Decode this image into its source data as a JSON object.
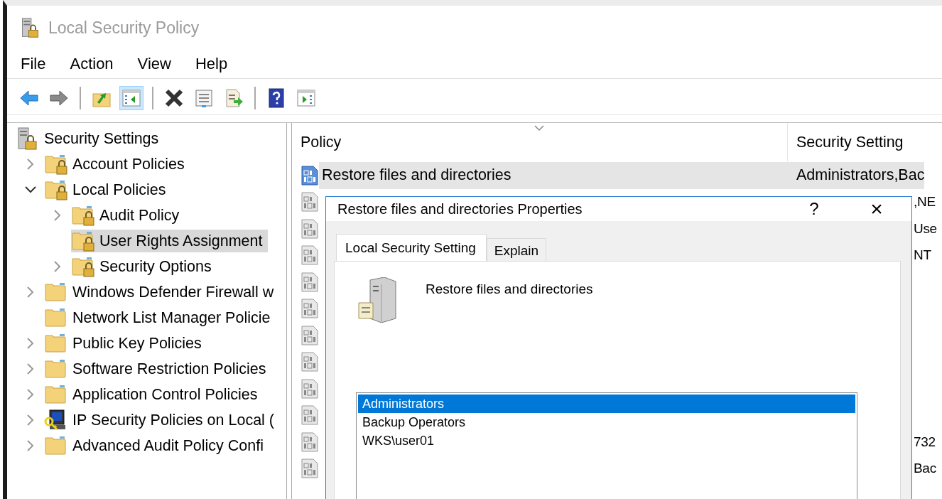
{
  "window": {
    "title": "Local Security Policy"
  },
  "menu": [
    "File",
    "Action",
    "View",
    "Help"
  ],
  "toolbar": [
    {
      "kind": "back"
    },
    {
      "kind": "forward"
    },
    {
      "kind": "separator"
    },
    {
      "kind": "up-folder"
    },
    {
      "kind": "console-tree",
      "pressed": true
    },
    {
      "kind": "separator"
    },
    {
      "kind": "delete"
    },
    {
      "kind": "properties"
    },
    {
      "kind": "export"
    },
    {
      "kind": "separator"
    },
    {
      "kind": "help"
    },
    {
      "kind": "action-pane"
    }
  ],
  "tree": {
    "label": "Security Settings",
    "kind": "server-lock",
    "selected": false,
    "children": [
      {
        "label": "Account Policies",
        "kind": "locked-folder",
        "expanded": false,
        "selected": false
      },
      {
        "label": "Local Policies",
        "kind": "locked-folder",
        "expanded": true,
        "selected": false,
        "children": [
          {
            "label": "Audit Policy",
            "kind": "locked-folder",
            "expanded": false,
            "selected": false
          },
          {
            "label": "User Rights Assignment",
            "kind": "locked-folder",
            "selected": true
          },
          {
            "label": "Security Options",
            "kind": "locked-folder",
            "expanded": false,
            "selected": false
          }
        ]
      },
      {
        "label": "Windows Defender Firewall w",
        "kind": "folder",
        "expanded": false,
        "selected": false
      },
      {
        "label": "Network List Manager Policie",
        "kind": "folder",
        "selected": false
      },
      {
        "label": "Public Key Policies",
        "kind": "folder",
        "expanded": false,
        "selected": false
      },
      {
        "label": "Software Restriction Policies",
        "kind": "folder",
        "expanded": false,
        "selected": false
      },
      {
        "label": "Application Control Policies",
        "kind": "folder",
        "expanded": false,
        "selected": false
      },
      {
        "label": "IP Security Policies on Local (",
        "kind": "ip-security",
        "expanded": false,
        "selected": false
      },
      {
        "label": "Advanced Audit Policy Confi",
        "kind": "folder",
        "expanded": false,
        "selected": false
      }
    ]
  },
  "table": {
    "columns": [
      "Policy",
      "Security Setting"
    ],
    "rows": [
      {
        "policy": "Restore files and directories",
        "setting": "Administrators,Bac",
        "selected": true
      },
      {
        "setting": ",NE",
        "selected": false
      },
      {
        "setting": "Use",
        "selected": false
      },
      {
        "setting": "NT",
        "selected": false
      },
      {
        "selected": false
      },
      {
        "selected": false
      },
      {
        "selected": false
      },
      {
        "selected": false
      },
      {
        "selected": false
      },
      {
        "selected": false
      },
      {
        "setting": "732",
        "selected": false
      },
      {
        "setting": "Bac",
        "selected": false
      }
    ]
  },
  "dialog": {
    "title": "Restore files and directories Properties",
    "help": "?",
    "close": "×",
    "tabs": [
      {
        "label": "Local Security Setting",
        "selected": true
      },
      {
        "label": "Explain",
        "selected": false
      }
    ],
    "policy_name": "Restore files and directories",
    "members": [
      {
        "name": "Administrators",
        "selected": true
      },
      {
        "name": "Backup Operators",
        "selected": false
      },
      {
        "name": "WKS\\user01",
        "selected": false
      }
    ]
  }
}
